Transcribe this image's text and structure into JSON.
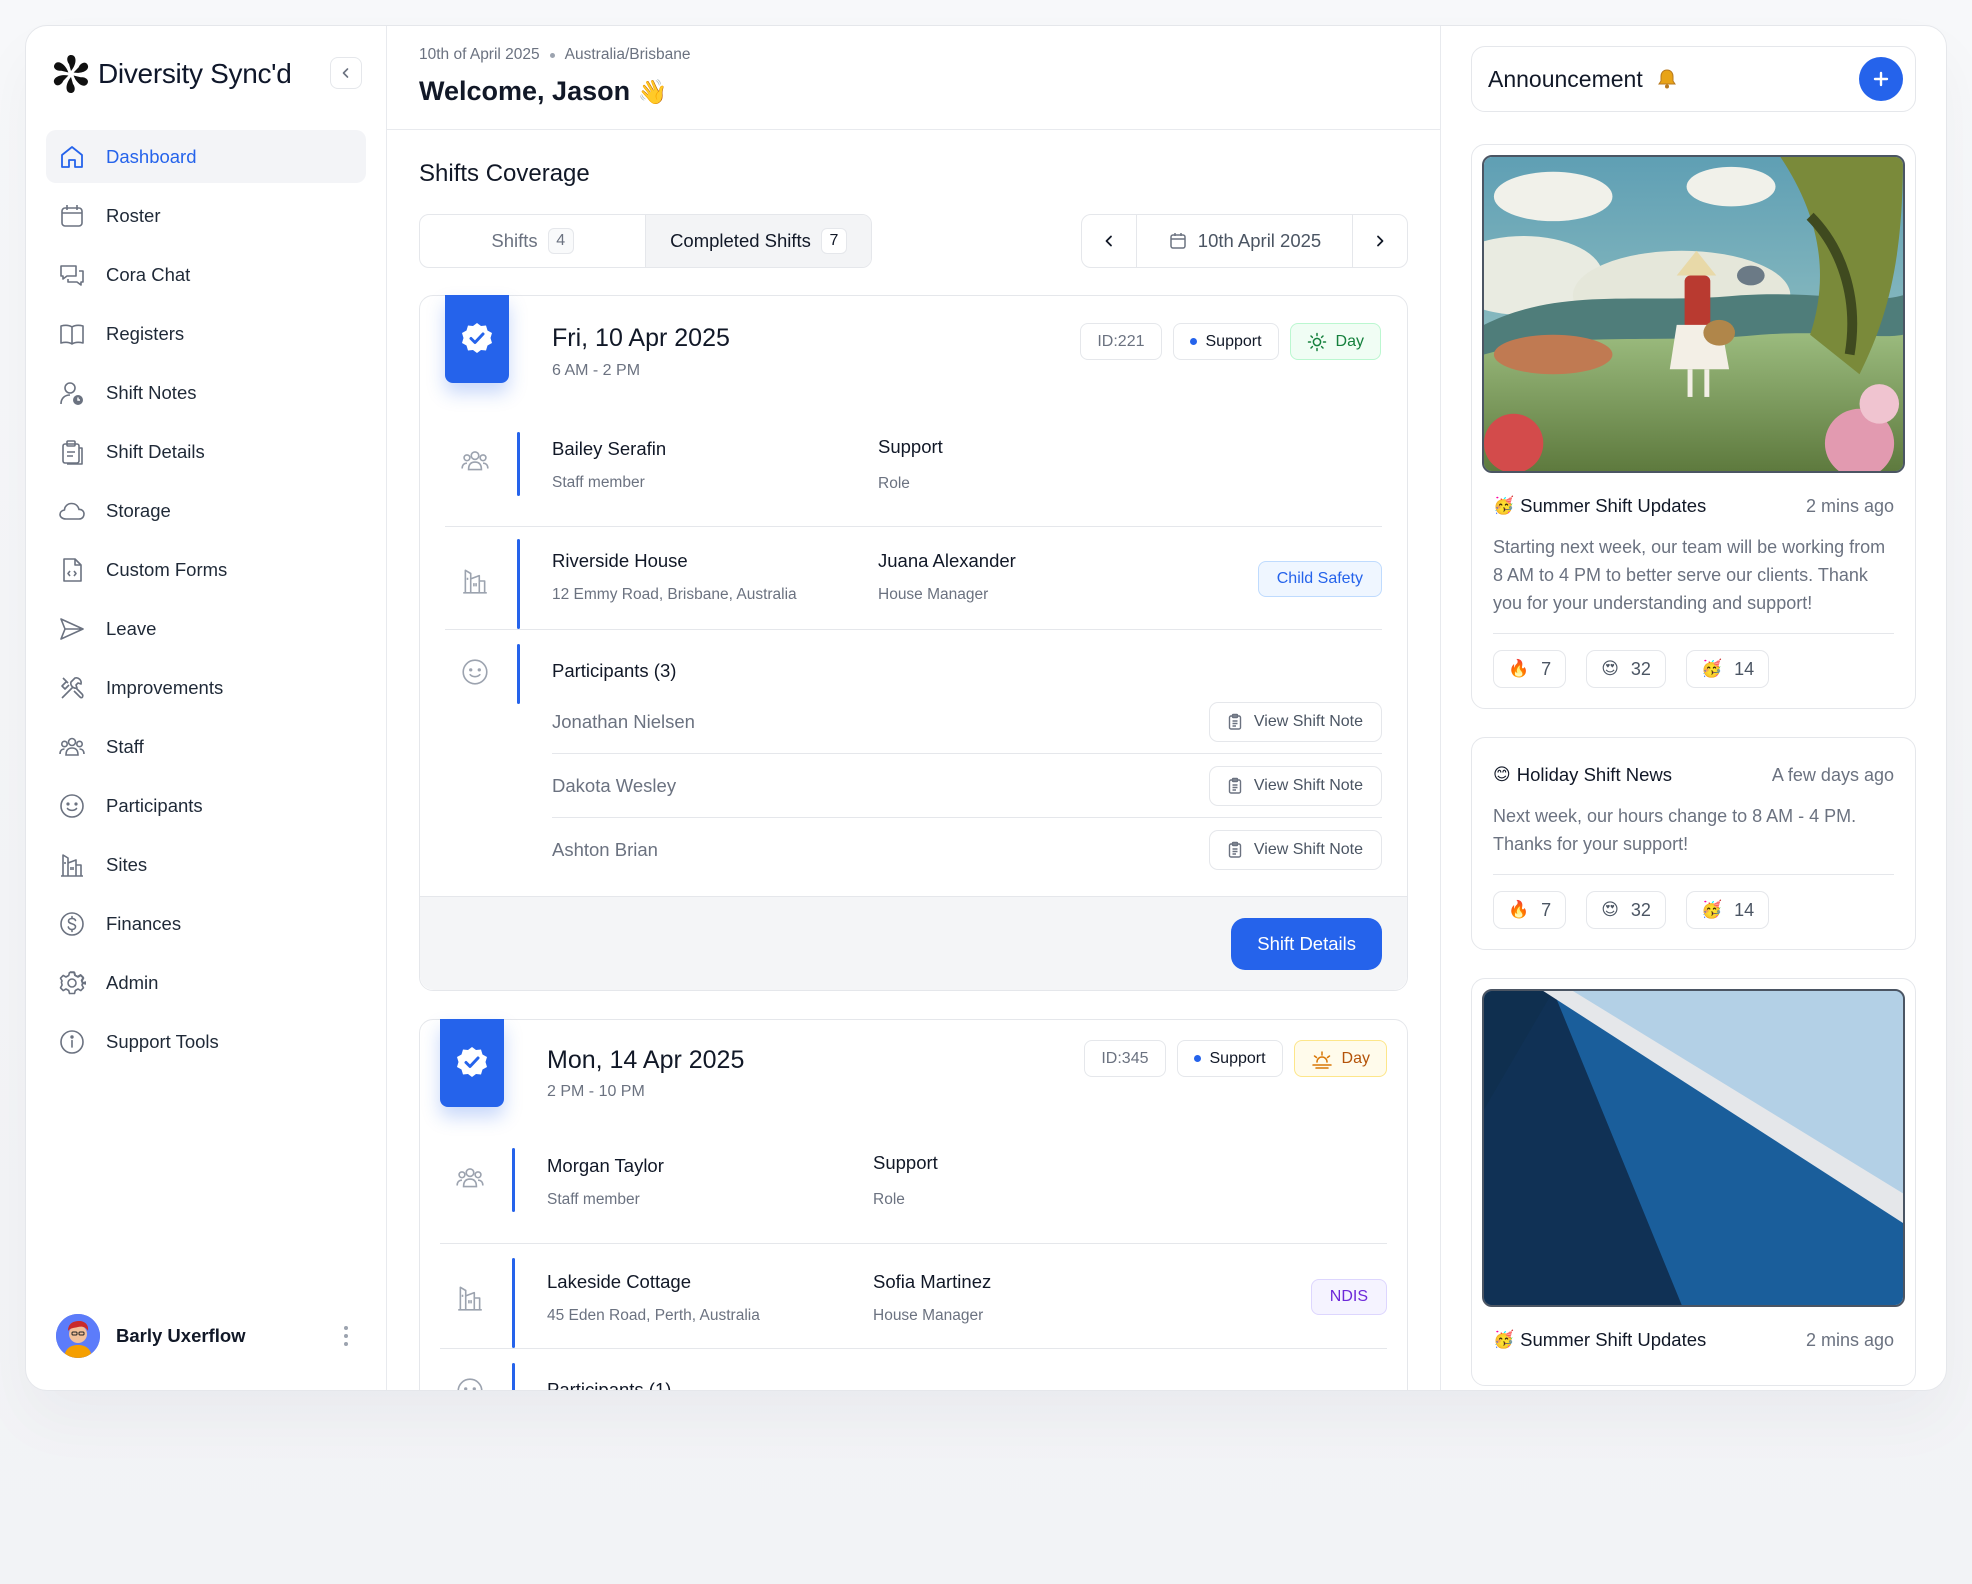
{
  "sidebar": {
    "brand": "Diversity Sync'd",
    "items": [
      {
        "label": "Dashboard",
        "icon": "home-icon",
        "active": true
      },
      {
        "label": "Roster",
        "icon": "calendar-icon"
      },
      {
        "label": "Cora Chat",
        "icon": "chat-icon"
      },
      {
        "label": "Registers",
        "icon": "book-icon"
      },
      {
        "label": "Shift Notes",
        "icon": "user-clock-icon"
      },
      {
        "label": "Shift Details",
        "icon": "clipboard-icon"
      },
      {
        "label": "Storage",
        "icon": "cloud-icon"
      },
      {
        "label": "Custom Forms",
        "icon": "file-code-icon"
      },
      {
        "label": "Leave",
        "icon": "send-icon"
      },
      {
        "label": "Improvements",
        "icon": "tools-icon"
      },
      {
        "label": "Staff",
        "icon": "users-icon"
      },
      {
        "label": "Participants",
        "icon": "smile-icon"
      },
      {
        "label": "Sites",
        "icon": "building-icon"
      },
      {
        "label": "Finances",
        "icon": "dollar-icon"
      },
      {
        "label": "Admin",
        "icon": "settings-icon"
      },
      {
        "label": "Support Tools",
        "icon": "info-icon"
      }
    ],
    "user": {
      "name": "Barly Uxerflow"
    }
  },
  "header": {
    "date": "10th of April 2025",
    "timezone": "Australia/Brisbane",
    "welcome": "Welcome, Jason",
    "wave": "👋"
  },
  "coverage": {
    "title": "Shifts Coverage",
    "tabs": [
      {
        "label": "Shifts",
        "count": "4"
      },
      {
        "label": "Completed Shifts",
        "count": "7",
        "active": true
      }
    ],
    "current_date": "10th April 2025",
    "shifts": [
      {
        "date": "Fri, 10 Apr 2025",
        "time": "6 AM - 2 PM",
        "id": "ID:221",
        "type": "Support",
        "period": "Day",
        "staff_name": "Bailey Serafin",
        "staff_caption": "Staff member",
        "role_name": "Support",
        "role_caption": "Role",
        "site_name": "Riverside House",
        "site_address": "12 Emmy Road, Brisbane, Australia",
        "manager_name": "Juana Alexander",
        "manager_caption": "House Manager",
        "tag": "Child Safety",
        "participants_title": "Participants (3)",
        "participants": [
          "Jonathan Nielsen",
          "Dakota Wesley",
          "Ashton Brian"
        ],
        "view_note_label": "View Shift Note",
        "details_label": "Shift Details"
      },
      {
        "date": "Mon, 14 Apr 2025",
        "time": "2 PM - 10 PM",
        "id": "ID:345",
        "type": "Support",
        "period": "Day",
        "staff_name": "Morgan Taylor",
        "staff_caption": "Staff member",
        "role_name": "Support",
        "role_caption": "Role",
        "site_name": "Lakeside Cottage",
        "site_address": "45 Eden Road, Perth, Australia",
        "manager_name": "Sofia Martinez",
        "manager_caption": "House Manager",
        "tag": "NDIS",
        "participants_title": "Participants (1)"
      }
    ]
  },
  "announcements": {
    "title": "Announcement",
    "posts": [
      {
        "emoji": "🥳",
        "title": "Summer Shift Updates",
        "time": "2 mins ago",
        "text": "Starting next week, our team will be working from 8 AM to 4 PM to better serve our clients. Thank you for your understanding and support!",
        "reactions": [
          {
            "emoji": "🔥",
            "count": "7"
          },
          {
            "emoji": "😍",
            "count": "32"
          },
          {
            "emoji": "🥳",
            "count": "14"
          }
        ]
      },
      {
        "emoji": "😊",
        "title": "Holiday Shift News",
        "time": "A few days ago",
        "text": "Next week, our hours change to 8 AM - 4 PM. Thanks for your support!",
        "reactions": [
          {
            "emoji": "🔥",
            "count": "7"
          },
          {
            "emoji": "😍",
            "count": "32"
          },
          {
            "emoji": "🥳",
            "count": "14"
          }
        ]
      },
      {
        "emoji": "🥳",
        "title": "Summer Shift Updates",
        "time": "2 mins ago"
      }
    ]
  },
  "colors": {
    "accent": "#2563eb",
    "border": "#e5e7eb",
    "muted": "#6b7280"
  }
}
